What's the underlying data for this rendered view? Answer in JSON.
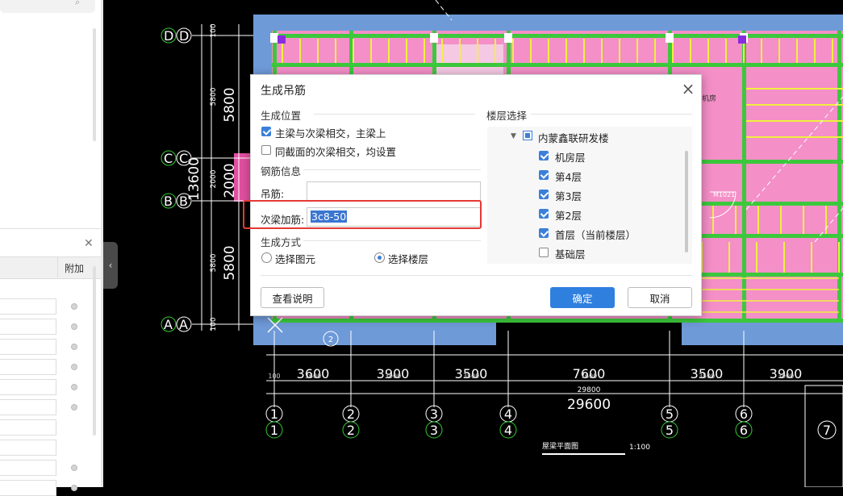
{
  "dialog": {
    "title": "生成吊筋",
    "position_section": "生成位置",
    "opt1": "主梁与次梁相交，主梁上",
    "opt1_checked": true,
    "opt2": "同截面的次梁相交，均设置",
    "opt2_checked": false,
    "rebar_section": "钢筋信息",
    "hanger_label": "吊筋:",
    "hanger_value": "",
    "secondary_label": "次梁加筋:",
    "secondary_value": "3c8-50",
    "method_section": "生成方式",
    "method_opt1": "选择图元",
    "method_opt2": "选择楼层",
    "method_selected": "选择楼层",
    "floor_section": "楼层选择",
    "project": "内蒙鑫联研发楼",
    "floors": [
      {
        "name": "机房层",
        "checked": true
      },
      {
        "name": "第4层",
        "checked": true
      },
      {
        "name": "第3层",
        "checked": true
      },
      {
        "name": "第2层",
        "checked": true
      },
      {
        "name": "首层（当前楼层）",
        "checked": true
      },
      {
        "name": "基础层",
        "checked": false
      }
    ],
    "help_btn": "查看说明",
    "ok_btn": "确定",
    "cancel_btn": "取消"
  },
  "left_panel": {
    "column_header": "附加"
  },
  "cad": {
    "row_axes": [
      "D",
      "C",
      "B",
      "A"
    ],
    "row_dims": [
      "5800",
      "2000",
      "5800"
    ],
    "row_dims_small": [
      "100",
      "5800",
      "2000",
      "5800",
      "100"
    ],
    "total_vertical": "13600",
    "col_axes": [
      "1",
      "2",
      "3",
      "4",
      "5",
      "6",
      "7"
    ],
    "col_dims": [
      "3600",
      "3900",
      "3500",
      "7600",
      "3500",
      "3900"
    ],
    "col_dims_small": [
      "100",
      "3600",
      "3900",
      "3500",
      "7600",
      "3500",
      "3900"
    ],
    "total_horizontal": "29600",
    "total_horizontal_small": "29800",
    "drawing_title": "屋梁平面图",
    "scale": "1:100",
    "room_label": "机房",
    "door_label": "M1021",
    "note": "2",
    "colors": {
      "slab": "#f48fc8",
      "beam": "#3cc83c",
      "rebar": "#f0f040",
      "edge": "#6f9ad8"
    }
  }
}
